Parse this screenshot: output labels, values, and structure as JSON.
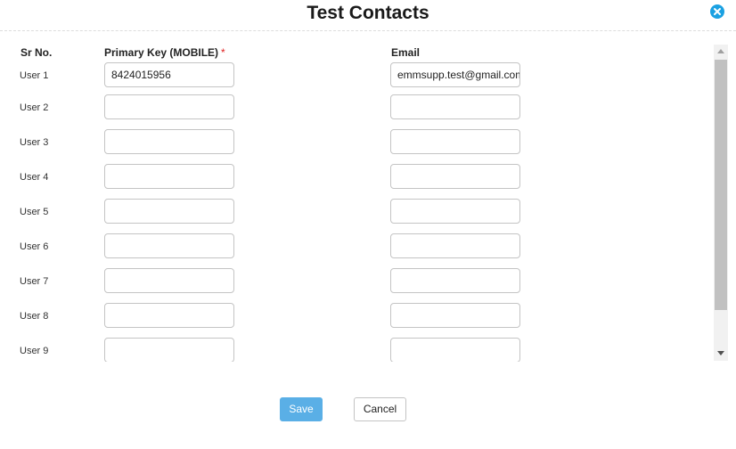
{
  "modal": {
    "title": "Test Contacts"
  },
  "table": {
    "headers": {
      "sr_no": "Sr No.",
      "primary_key": "Primary Key (MOBILE)",
      "required_mark": "*",
      "email": "Email"
    },
    "rows": [
      {
        "label": "User 1",
        "mobile": "8424015956",
        "email": "emmsupp.test@gmail.com"
      },
      {
        "label": "User 2",
        "mobile": "",
        "email": ""
      },
      {
        "label": "User 3",
        "mobile": "",
        "email": ""
      },
      {
        "label": "User 4",
        "mobile": "",
        "email": ""
      },
      {
        "label": "User 5",
        "mobile": "",
        "email": ""
      },
      {
        "label": "User 6",
        "mobile": "",
        "email": ""
      },
      {
        "label": "User 7",
        "mobile": "",
        "email": ""
      },
      {
        "label": "User 8",
        "mobile": "",
        "email": ""
      },
      {
        "label": "User 9",
        "mobile": "",
        "email": ""
      }
    ]
  },
  "footer": {
    "save_label": "Save",
    "cancel_label": "Cancel"
  },
  "colors": {
    "accent": "#1ba1e2",
    "save_button": "#5aafe6",
    "required": "#e02020"
  },
  "icons": {
    "close": "close-icon",
    "scroll_up": "scroll-up-arrow-icon",
    "scroll_down": "scroll-down-arrow-icon"
  }
}
